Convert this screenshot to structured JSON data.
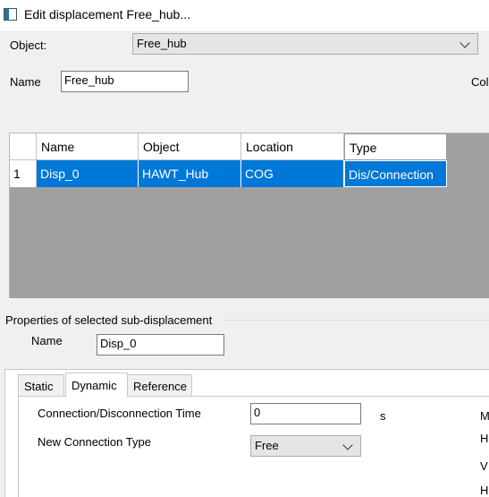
{
  "window": {
    "title": "Edit displacement Free_hub..."
  },
  "object_row": {
    "label": "Object:",
    "value": "Free_hub"
  },
  "name_row": {
    "label": "Name",
    "value": "Free_hub",
    "cut_label": "Col"
  },
  "grid": {
    "columns": [
      "Name",
      "Object",
      "Location",
      "Type"
    ],
    "rows": [
      {
        "index": "1",
        "cells": [
          "Disp_0",
          "HAWT_Hub",
          "COG",
          "Dis/Connection"
        ]
      }
    ]
  },
  "sub": {
    "title": "Properties of selected sub-displacement",
    "name_label": "Name",
    "name_value": "Disp_0"
  },
  "tabs": [
    "Static",
    "Dynamic",
    "Reference"
  ],
  "active_tab": "Dynamic",
  "dynamic": {
    "time_label": "Connection/Disconnection Time",
    "time_value": "0",
    "time_unit": "s",
    "type_label": "New Connection Type",
    "type_value": "Free",
    "cut_labels": [
      "M",
      "H",
      "V",
      "H"
    ]
  }
}
